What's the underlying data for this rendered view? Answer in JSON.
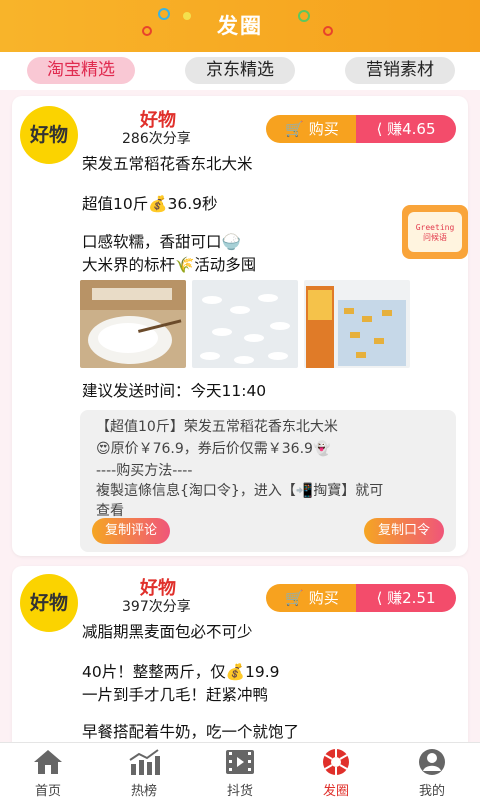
{
  "header": {
    "title": "发圈"
  },
  "tabs": [
    "淘宝精选",
    "京东精选",
    "营销素材"
  ],
  "posts": [
    {
      "avatar_text": "好物",
      "name": "好物",
      "shares": "286次分享",
      "buy_label": "购买",
      "earn_label": "赚4.65",
      "lines": [
        "荣发五常稻花香东北大米",
        "超值10斤💰36.9秒",
        "口感软糯，香甜可口🍚",
        "大米界的标杆🌾活动多囤"
      ],
      "send_time": "建议发送时间：今天11:40",
      "comment_lines": [
        "【超值10斤】荣发五常稻花香东北大米",
        "😍原价￥76.9，券后价仅需￥36.9👻",
        "----购买方法----",
        "複製這條信息{淘口令}，进入【📲掏寶】就可",
        "查看"
      ],
      "copy_comment": "复制评论",
      "copy_code": "复制口令"
    },
    {
      "avatar_text": "好物",
      "name": "好物",
      "shares": "397次分享",
      "buy_label": "购买",
      "earn_label": "赚2.51",
      "lines": [
        "减脂期黑麦面包必不可少",
        "40片！整整两斤，仅💰19.9",
        "一片到手才几毛！赶紧冲鸭",
        "早餐搭配着牛奶，吃一个就饱了"
      ]
    }
  ],
  "float_badge": {
    "line1": "Greeting",
    "line2": "问候语"
  },
  "nav": {
    "items": [
      {
        "label": "首页",
        "icon": "home-icon"
      },
      {
        "label": "热榜",
        "icon": "chart-icon"
      },
      {
        "label": "抖货",
        "icon": "video-icon"
      },
      {
        "label": "发圈",
        "icon": "aperture-icon"
      },
      {
        "label": "我的",
        "icon": "user-icon"
      }
    ]
  },
  "colors": {
    "header": "#f8b42a",
    "accent_red": "#e0302b",
    "earn_pink": "#f34c6b",
    "buy_orange": "#f7a21f"
  }
}
